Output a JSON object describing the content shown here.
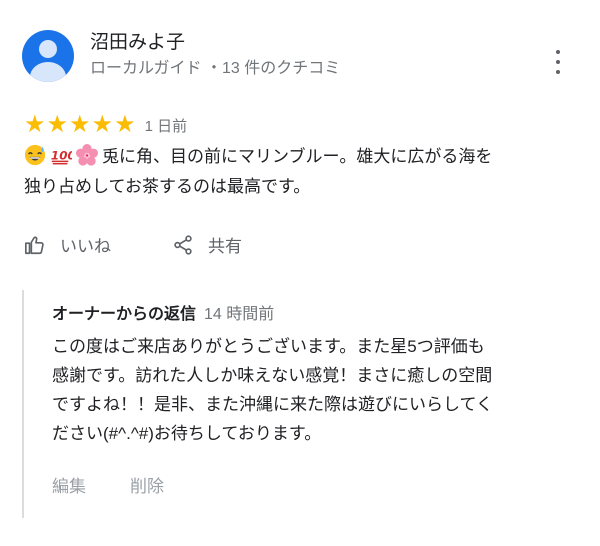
{
  "reviewer": {
    "name": "沼田みよ子",
    "meta": "ローカルガイド ・13 件のクチコミ"
  },
  "rating": {
    "stars_filled": 5,
    "stars_total": 5,
    "stars_text": "★★★★★",
    "date": "1 日前",
    "star_color": "#fbbc04"
  },
  "review": {
    "emojis": [
      "grinning-sweat-icon",
      "hundred-points-icon",
      "cherry-blossom-icon"
    ],
    "text_line1": "兎に角、目の前にマリンブルー。雄大に広がる海を",
    "text_line2": "独り占めしてお茶するのは最高です。"
  },
  "actions": {
    "like_label": "いいね",
    "share_label": "共有"
  },
  "owner_reply": {
    "label": "オーナーからの返信",
    "date": "14 時間前",
    "line1": "この度はご来店ありがとうございます。また星5つ評価も",
    "line2": "感謝です。訪れた人しか味えない感覚！まさに癒しの空間",
    "line3": "ですよね！！是非、また沖縄に来た際は遊びにいらしてく",
    "line4": "ださい(#^.^#)お待ちしております。",
    "edit_label": "編集",
    "delete_label": "削除"
  },
  "colors": {
    "avatar": "#1a73e8",
    "meta_text": "#70757a",
    "reply_border": "#dadce0"
  }
}
